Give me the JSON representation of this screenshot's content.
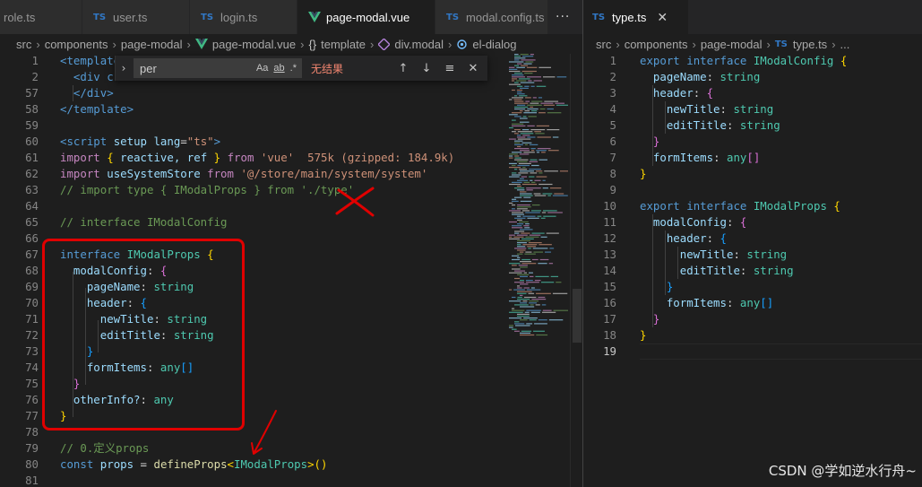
{
  "left_editor": {
    "tabs": [
      {
        "label": "role.ts",
        "type": "ts-partial"
      },
      {
        "label": "user.ts",
        "type": "ts"
      },
      {
        "label": "login.ts",
        "type": "ts"
      },
      {
        "label": "page-modal.vue",
        "type": "vue",
        "active": true
      },
      {
        "label": "modal.config.ts",
        "type": "ts"
      }
    ],
    "more_actions": "···",
    "breadcrumb": [
      "src",
      "components",
      "page-modal",
      "page-modal.vue",
      "template",
      "div.modal",
      "el-dialog"
    ],
    "find": {
      "query": "per",
      "opt_case": "Aa",
      "opt_word": "ab",
      "opt_regex": ".*",
      "result": "无结果"
    },
    "line_numbers": [
      "1",
      "2",
      "57",
      "58",
      "59",
      "60",
      "61",
      "62",
      "63",
      "64",
      "65",
      "66",
      "67",
      "68",
      "69",
      "70",
      "71",
      "72",
      "73",
      "74",
      "75",
      "76",
      "77",
      "78",
      "79",
      "80",
      "81"
    ],
    "code": {
      "l1": "<template>",
      "l2": "<div c",
      "l57": "</div>",
      "l58": "</template>",
      "l60_kw": "<script",
      "l60_attr": "setup",
      "l60_lang": "lang",
      "l60_val": "\"ts\"",
      "l60_end": ">",
      "l61_import": "import",
      "l61_names": "reactive, ref",
      "l61_from": "from",
      "l61_mod": "'vue'",
      "l61_size": "575k (gzipped: 184.9k)",
      "l62_import": "import",
      "l62_name": "useSystemStore",
      "l62_from": "from",
      "l62_mod": "'@/store/main/system/system'",
      "l63": "// import type { IModalProps } from './type'",
      "l65": "// interface IModalConfig",
      "l67_kw": "interface",
      "l67_name": "IModalProps",
      "l68_prop": "modalConfig",
      "l69_prop": "pageName",
      "l69_type": "string",
      "l70_prop": "header",
      "l71_prop": "newTitle",
      "l71_type": "string",
      "l72_prop": "editTitle",
      "l72_type": "string",
      "l74_prop": "formItems",
      "l74_type": "any",
      "l76_prop": "otherInfo?",
      "l76_type": "any",
      "l79": "// 0.定义props",
      "l80_const": "const",
      "l80_var": "props",
      "l80_fn": "defineProps",
      "l80_type": "IModalProps"
    }
  },
  "right_editor": {
    "tab": {
      "label": "type.ts",
      "close": "✕"
    },
    "breadcrumb": [
      "src",
      "components",
      "page-modal",
      "type.ts",
      "..."
    ],
    "line_numbers": [
      "1",
      "2",
      "3",
      "4",
      "5",
      "6",
      "7",
      "8",
      "9",
      "10",
      "11",
      "12",
      "13",
      "14",
      "15",
      "16",
      "17",
      "18",
      "19"
    ],
    "code": {
      "export": "export",
      "interface": "interface",
      "name1": "IModalConfig",
      "name2": "IModalProps",
      "pageName": "pageName",
      "header": "header",
      "newTitle": "newTitle",
      "editTitle": "editTitle",
      "formItems": "formItems",
      "modalConfig": "modalConfig",
      "string": "string",
      "any": "any"
    }
  },
  "watermark": "CSDN @学如逆水行舟~",
  "colors": {
    "annotation_red": "#e00000",
    "ts_blue": "#3178c6",
    "vue_green": "#41b883"
  }
}
